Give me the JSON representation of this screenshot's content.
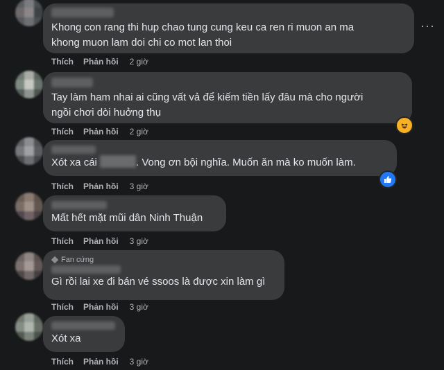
{
  "actions": {
    "like": "Thích",
    "reply": "Phản hồi"
  },
  "comments": [
    {
      "text_lines": [
        "Khong con rang thi hup chao tung cung keu ca ren ri muon an ma",
        "khong muon lam doi chi co mot lan thoi"
      ],
      "time": "2 giờ"
    },
    {
      "text_lines": [
        "Tay làm ham nhai ai cũng vất vả để kiếm tiền lấy đâu mà cho người",
        "ngồi chơi dòi huởng thụ"
      ],
      "time": "2 giờ",
      "reaction": "haha-icon"
    },
    {
      "text_before": "Xót xa cái",
      "text_after": ". Vong ơn bội nghĩa. Muốn ăn mà ko muốn làm.",
      "time": "3 giờ",
      "reaction": "like-icon"
    },
    {
      "text_lines": [
        "Mất hết mặt mũi dân Ninh Thuận"
      ],
      "time": "3 giờ"
    },
    {
      "badge": "Fan cứng",
      "text_lines": [
        "Gì rồi lai xe đi bán vé ssoos là được xin làm gì"
      ],
      "time": "3 giờ"
    },
    {
      "text_lines": [
        "Xót xa"
      ],
      "time": "3 giờ"
    }
  ],
  "colors": {
    "background": "#18191a",
    "bubble": "#3a3b3c",
    "text": "#e4e6eb",
    "muted": "#b0b3b8",
    "like_blue": "#2078f4",
    "haha_yellow": "#f7b125"
  }
}
